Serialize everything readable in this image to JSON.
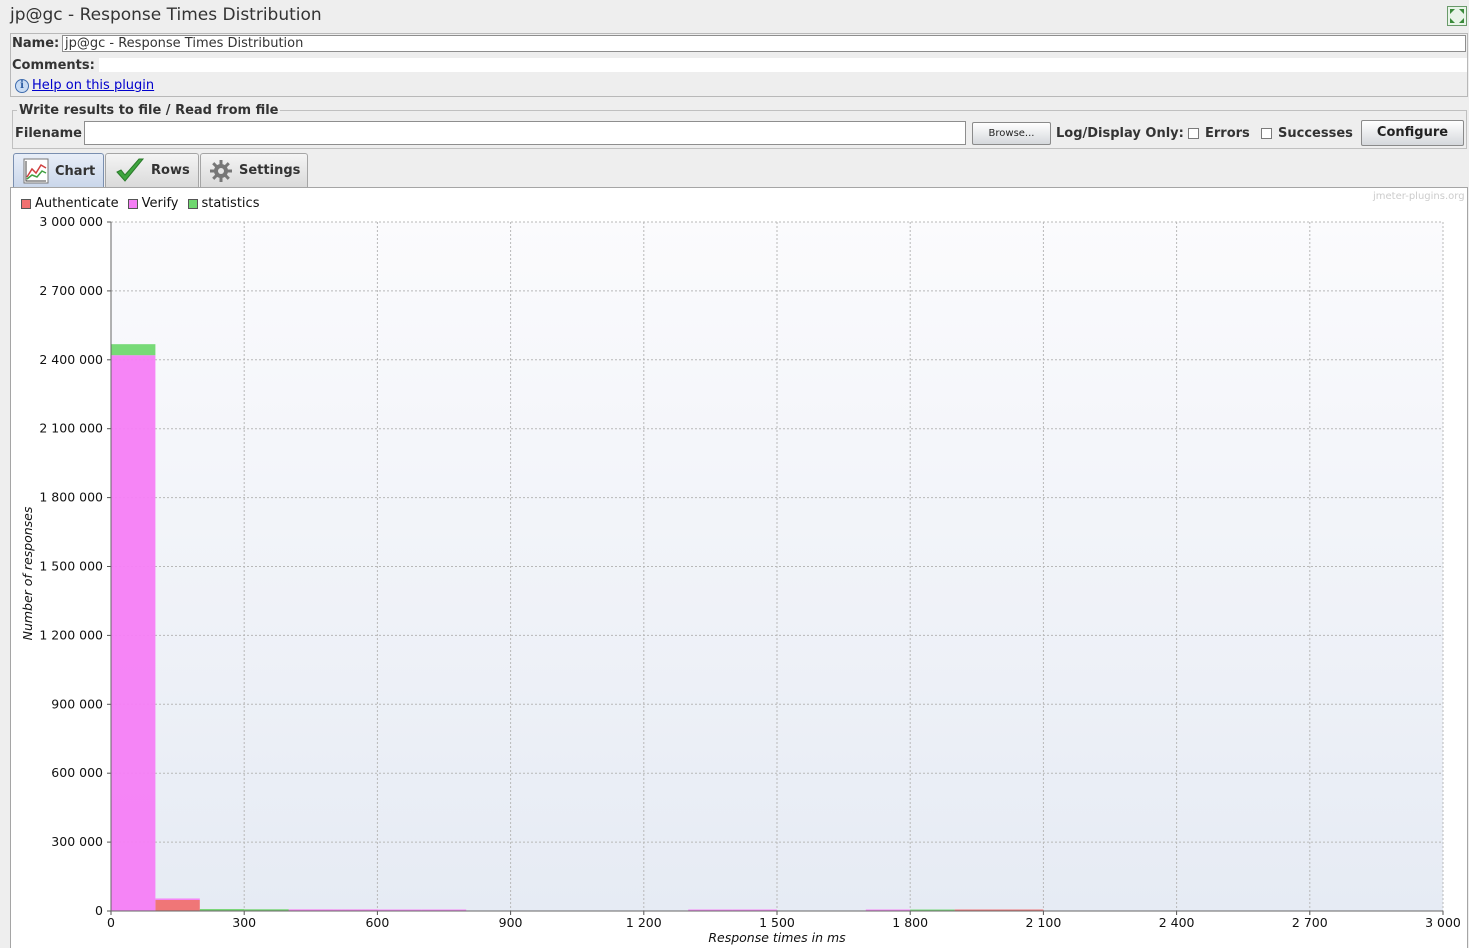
{
  "window": {
    "title": "jp@gc - Response Times Distribution"
  },
  "form": {
    "name_label": "Name:",
    "name_value": "jp@gc - Response Times Distribution",
    "comments_label": "Comments:",
    "help_link": "Help on this plugin"
  },
  "file_panel": {
    "legend": "Write results to file / Read from file",
    "filename_label": "Filename",
    "filename_value": "",
    "browse_label": "Browse...",
    "log_display_label": "Log/Display Only:",
    "errors_label": "Errors",
    "successes_label": "Successes",
    "configure_label": "Configure"
  },
  "tabs": [
    {
      "label": "Chart",
      "icon": "chart-icon",
      "active": true
    },
    {
      "label": "Rows",
      "icon": "checkmark-icon",
      "active": false
    },
    {
      "label": "Settings",
      "icon": "gear-icon",
      "active": false
    }
  ],
  "watermark": "jmeter-plugins.org",
  "chart_data": {
    "type": "bar",
    "stacked": true,
    "xlabel": "Response times in ms",
    "ylabel": "Number of responses",
    "xlim": [
      0,
      3000
    ],
    "ylim": [
      0,
      3000000
    ],
    "xticks": [
      0,
      300,
      600,
      900,
      1200,
      1500,
      1800,
      2100,
      2400,
      2700,
      3000
    ],
    "xtick_labels": [
      "0",
      "300",
      "600",
      "900",
      "1 200",
      "1 500",
      "1 800",
      "2 100",
      "2 400",
      "2 700",
      "3 000"
    ],
    "yticks": [
      0,
      300000,
      600000,
      900000,
      1200000,
      1500000,
      1800000,
      2100000,
      2400000,
      2700000,
      3000000
    ],
    "ytick_labels": [
      "0",
      "300 000",
      "600 000",
      "900 000",
      "1 200 000",
      "1 500 000",
      "1 800 000",
      "2 100 000",
      "2 400 000",
      "2 700 000",
      "3 000 000"
    ],
    "bin_width": 100,
    "grid": true,
    "legend_position": "top-left",
    "series": [
      {
        "name": "Authenticate",
        "color": "#f07070",
        "bins": [
          0,
          100,
          200,
          300,
          400,
          500,
          1900,
          2000
        ],
        "values": [
          0,
          48000,
          2000,
          1000,
          500,
          300,
          1500,
          1200
        ]
      },
      {
        "name": "Verify",
        "color": "#f57ef5",
        "bins": [
          0,
          100,
          400,
          500,
          600,
          700,
          1300,
          1400,
          1700
        ],
        "values": [
          2420000,
          1500,
          1500,
          1500,
          1500,
          1500,
          1500,
          1500,
          1500
        ]
      },
      {
        "name": "statistics",
        "color": "#70d870",
        "bins": [
          0,
          200,
          300,
          1800
        ],
        "values": [
          48000,
          3000,
          2000,
          2000
        ]
      }
    ]
  }
}
